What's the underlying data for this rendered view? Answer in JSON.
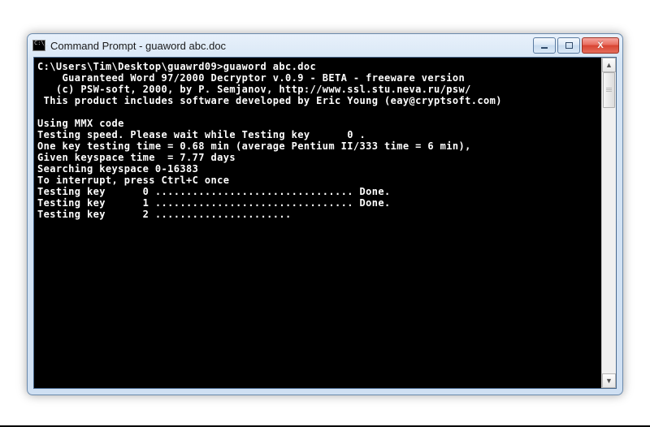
{
  "window": {
    "title": "Command Prompt - guaword  abc.doc",
    "buttons": {
      "minimize": "Minimize",
      "maximize": "Maximize",
      "close": "Close"
    }
  },
  "terminal": {
    "prompt": "C:\\Users\\Tim\\Desktop\\guawrd09>",
    "command": "guaword abc.doc",
    "banner_line1": "    Guaranteed Word 97/2000 Decryptor v.0.9 - BETA - freeware version",
    "banner_line2": "   (c) PSW-soft, 2000, by P. Semjanov, http://www.ssl.stu.neva.ru/psw/",
    "banner_line3": " This product includes software developed by Eric Young (eay@cryptsoft.com)",
    "blank": "",
    "mmx": "Using MMX code",
    "testing_speed": "Testing speed. Please wait while Testing key      0 .",
    "one_key_time": "One key testing time = 0.68 min (average Pentium II/333 time = 6 min),",
    "keyspace_time": "Given keyspace time  = 7.77 days",
    "searching": "Searching keyspace 0-16383",
    "interrupt": "To interrupt, press Ctrl+C once",
    "progress0": "Testing key      0 ................................ Done.",
    "progress1": "Testing key      1 ................................ Done.",
    "progress2": "Testing key      2 ......................"
  }
}
